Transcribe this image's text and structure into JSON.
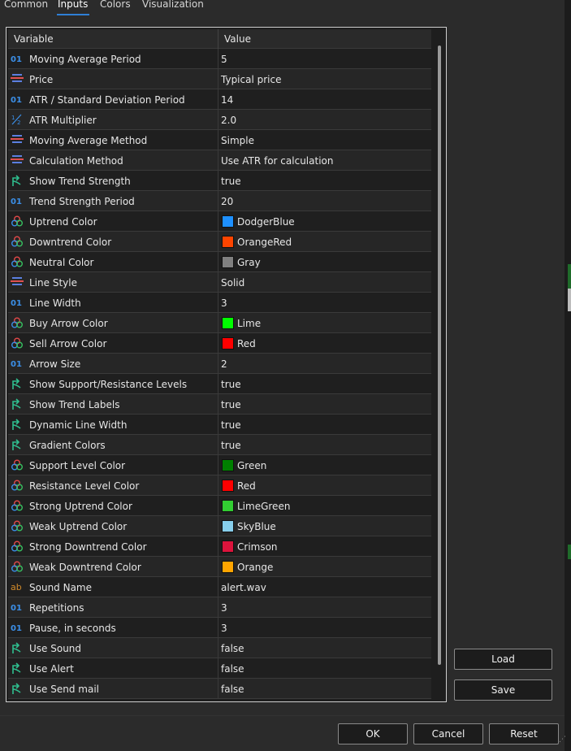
{
  "tabs": [
    {
      "label": "Common"
    },
    {
      "label": "Inputs",
      "active": true
    },
    {
      "label": "Colors"
    },
    {
      "label": "Visualization"
    }
  ],
  "grid": {
    "col_variable": "Variable",
    "col_value": "Value"
  },
  "rows": [
    {
      "icon": "int-icon",
      "name": "Moving Average Period",
      "value": "5"
    },
    {
      "icon": "enum-icon",
      "name": "Price",
      "value": "Typical price"
    },
    {
      "icon": "int-icon",
      "name": "ATR / Standard Deviation Period",
      "value": "14"
    },
    {
      "icon": "double-icon",
      "name": "ATR Multiplier",
      "value": "2.0"
    },
    {
      "icon": "enum-icon",
      "name": "Moving Average Method",
      "value": "Simple"
    },
    {
      "icon": "enum-icon",
      "name": "Calculation Method",
      "value": "Use ATR for calculation"
    },
    {
      "icon": "bool-icon",
      "name": "Show Trend Strength",
      "value": "true"
    },
    {
      "icon": "int-icon",
      "name": "Trend Strength Period",
      "value": "20"
    },
    {
      "icon": "color-icon",
      "name": "Uptrend Color",
      "value": "DodgerBlue",
      "swatch": "#1e90ff"
    },
    {
      "icon": "color-icon",
      "name": "Downtrend Color",
      "value": "OrangeRed",
      "swatch": "#ff4500"
    },
    {
      "icon": "color-icon",
      "name": "Neutral Color",
      "value": "Gray",
      "swatch": "#808080"
    },
    {
      "icon": "enum-icon",
      "name": "Line Style",
      "value": "Solid"
    },
    {
      "icon": "int-icon",
      "name": "Line Width",
      "value": "3"
    },
    {
      "icon": "color-icon",
      "name": "Buy Arrow Color",
      "value": "Lime",
      "swatch": "#00ff00"
    },
    {
      "icon": "color-icon",
      "name": "Sell Arrow Color",
      "value": "Red",
      "swatch": "#ff0000"
    },
    {
      "icon": "int-icon",
      "name": "Arrow Size",
      "value": "2"
    },
    {
      "icon": "bool-icon",
      "name": "Show Support/Resistance Levels",
      "value": "true"
    },
    {
      "icon": "bool-icon",
      "name": "Show Trend Labels",
      "value": "true"
    },
    {
      "icon": "bool-icon",
      "name": "Dynamic Line Width",
      "value": "true"
    },
    {
      "icon": "bool-icon",
      "name": "Gradient Colors",
      "value": "true"
    },
    {
      "icon": "color-icon",
      "name": "Support Level Color",
      "value": "Green",
      "swatch": "#008000"
    },
    {
      "icon": "color-icon",
      "name": "Resistance Level Color",
      "value": "Red",
      "swatch": "#ff0000"
    },
    {
      "icon": "color-icon",
      "name": "Strong Uptrend Color",
      "value": "LimeGreen",
      "swatch": "#32cd32"
    },
    {
      "icon": "color-icon",
      "name": "Weak Uptrend Color",
      "value": "SkyBlue",
      "swatch": "#87ceeb"
    },
    {
      "icon": "color-icon",
      "name": "Strong Downtrend Color",
      "value": "Crimson",
      "swatch": "#dc143c"
    },
    {
      "icon": "color-icon",
      "name": "Weak Downtrend Color",
      "value": "Orange",
      "swatch": "#ffa500"
    },
    {
      "icon": "string-icon",
      "name": "Sound Name",
      "value": "alert.wav"
    },
    {
      "icon": "int-icon",
      "name": "Repetitions",
      "value": "3"
    },
    {
      "icon": "int-icon",
      "name": "Pause, in seconds",
      "value": "3"
    },
    {
      "icon": "bool-icon",
      "name": "Use Sound",
      "value": "false"
    },
    {
      "icon": "bool-icon",
      "name": "Use Alert",
      "value": "false"
    },
    {
      "icon": "bool-icon",
      "name": "Use Send mail",
      "value": "false"
    }
  ],
  "buttons": {
    "load": "Load",
    "save": "Save",
    "ok": "OK",
    "cancel": "Cancel",
    "reset": "Reset"
  },
  "colors": {
    "accent": "#2f7fd6",
    "int_icon": "#3b8fe8",
    "bool_icon": "#2fbf8f",
    "string_icon": "#d08a2a"
  }
}
